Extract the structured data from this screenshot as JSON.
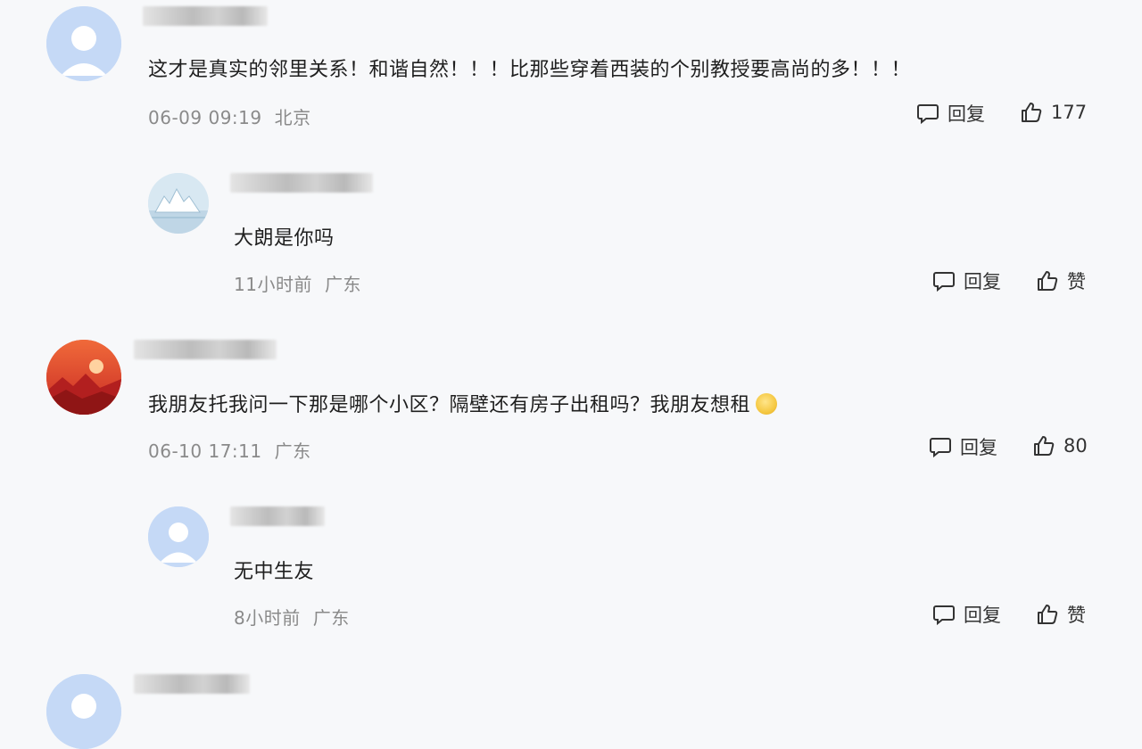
{
  "comments": [
    {
      "text": "这才是真实的邻里关系！和谐自然！！！比那些穿着西装的个别教授要高尚的多！！！",
      "time": "06-09 09:19",
      "location": "北京",
      "reply_label": "回复",
      "like_value": "177"
    },
    {
      "text": "大朗是你吗",
      "time": "11小时前",
      "location": "广东",
      "reply_label": "回复",
      "like_value": "赞"
    },
    {
      "text": "我朋友托我问一下那是哪个小区？隔壁还有房子出租吗？我朋友想租",
      "time": "06-10 17:11",
      "location": "广东",
      "reply_label": "回复",
      "like_value": "80"
    },
    {
      "text": "无中生友",
      "time": "8小时前",
      "location": "广东",
      "reply_label": "回复",
      "like_value": "赞"
    }
  ],
  "icons": {
    "reply": "comment-bubble-icon",
    "like": "thumbs-up-icon",
    "emoji": "smiley-emoji-icon"
  },
  "colors": {
    "background": "#f7f8fa",
    "meta_text": "#8a8a8a",
    "avatar_default": "#c9dcf7"
  }
}
